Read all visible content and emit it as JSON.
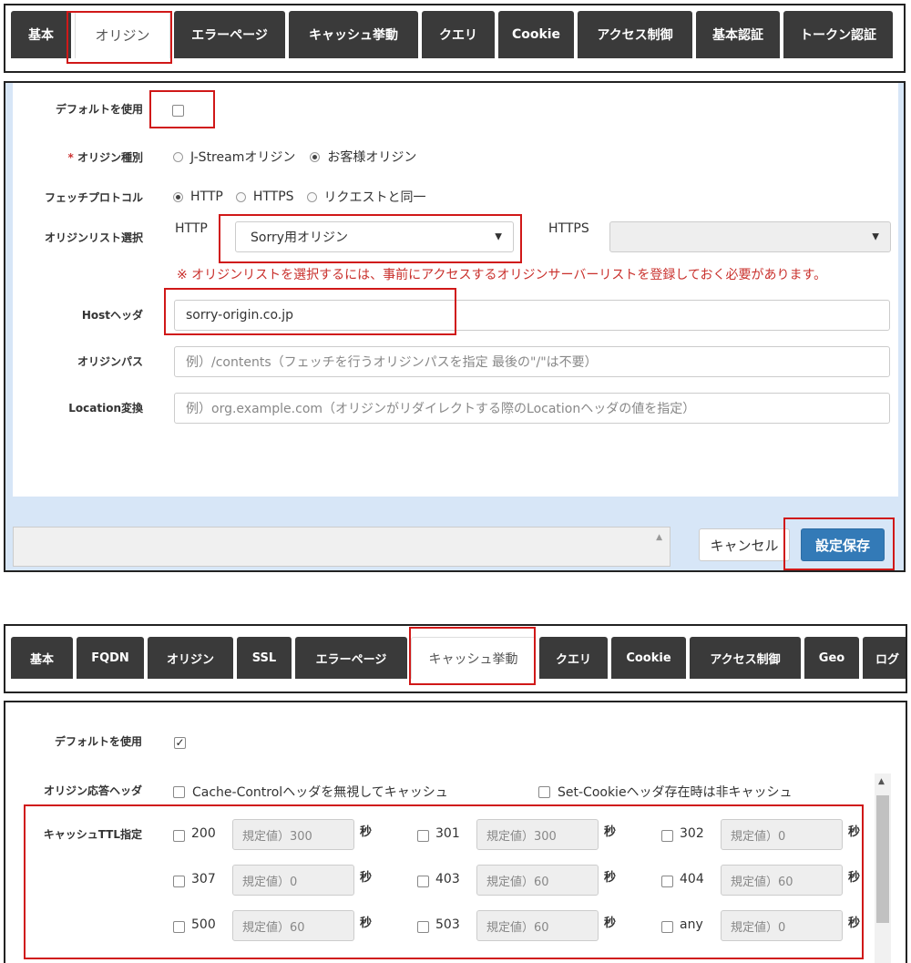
{
  "top_tabs": [
    "基本",
    "オリジン",
    "エラーページ",
    "キャッシュ挙動",
    "クエリ",
    "Cookie",
    "アクセス制御",
    "基本認証",
    "トークン認証"
  ],
  "origin_form": {
    "default_label": "デフォルトを使用",
    "required_mark": "*",
    "origin_type_label": "オリジン種別",
    "origin_type_options": [
      "J-Streamオリジン",
      "お客様オリジン"
    ],
    "fetch_protocol_label": "フェッチプロトコル",
    "fetch_protocol_options": [
      "HTTP",
      "HTTPS",
      "リクエストと同一"
    ],
    "origin_list_label": "オリジンリスト選択",
    "http_label": "HTTP",
    "http_select_value": "Sorry用オリジン",
    "https_label": "HTTPS",
    "https_select_value": "",
    "note": "※ オリジンリストを選択するには、事前にアクセスするオリジンサーバーリストを登録しておく必要があります。",
    "host_header_label": "Hostヘッダ",
    "host_header_value": "sorry-origin.co.jp",
    "origin_path_label": "オリジンパス",
    "origin_path_placeholder": "例）/contents（フェッチを行うオリジンパスを指定 最後の\"/\"は不要）",
    "location_label": "Location変換",
    "location_placeholder": "例）org.example.com（オリジンがリダイレクトする際のLocationヘッダの値を指定）",
    "cancel_button": "キャンセル",
    "save_button": "設定保存"
  },
  "bottom_tabs": [
    "基本",
    "FQDN",
    "オリジン",
    "SSL",
    "エラーページ",
    "キャッシュ挙動",
    "クエリ",
    "Cookie",
    "アクセス制御",
    "Geo",
    "ログ"
  ],
  "cache_form": {
    "default_label": "デフォルトを使用",
    "origin_header_label": "オリジン応答ヘッダ",
    "ignore_cache_control": "Cache-Controlヘッダを無視してキャッシュ",
    "set_cookie_nocache": "Set-Cookieヘッダ存在時は非キャッシュ",
    "ttl_label": "キャッシュTTL指定",
    "seconds_unit": "秒",
    "ttl_rows": [
      [
        {
          "code": "200",
          "ph": "規定値）300"
        },
        {
          "code": "301",
          "ph": "規定値）300"
        },
        {
          "code": "302",
          "ph": "規定値）0"
        }
      ],
      [
        {
          "code": "307",
          "ph": "規定値）0"
        },
        {
          "code": "403",
          "ph": "規定値）60"
        },
        {
          "code": "404",
          "ph": "規定値）60"
        }
      ],
      [
        {
          "code": "500",
          "ph": "規定値）60"
        },
        {
          "code": "503",
          "ph": "規定値）60"
        },
        {
          "code": "any",
          "ph": "規定値）0"
        }
      ]
    ]
  }
}
